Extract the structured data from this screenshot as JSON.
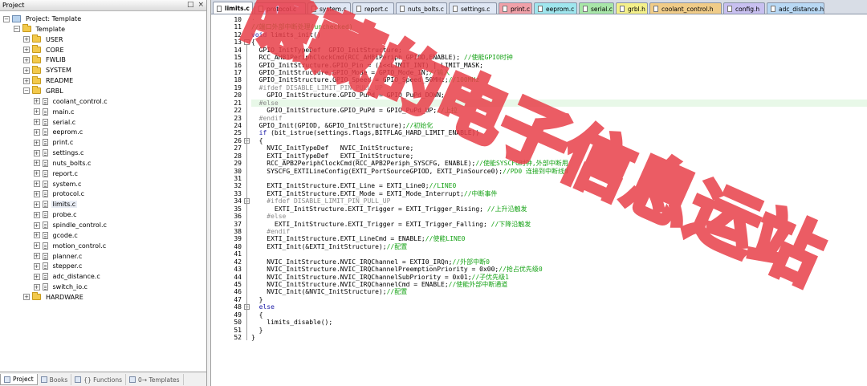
{
  "project_panel": {
    "title": "Project",
    "header_buttons": [
      "□",
      "×"
    ],
    "tree": [
      {
        "depth": 0,
        "expander": "−",
        "icon": "target",
        "label": "Project: Template"
      },
      {
        "depth": 1,
        "expander": "−",
        "icon": "folder",
        "label": "Template"
      },
      {
        "depth": 2,
        "expander": "+",
        "icon": "folder",
        "label": "USER"
      },
      {
        "depth": 2,
        "expander": "+",
        "icon": "folder",
        "label": "CORE"
      },
      {
        "depth": 2,
        "expander": "+",
        "icon": "folder",
        "label": "FWLIB"
      },
      {
        "depth": 2,
        "expander": "+",
        "icon": "folder",
        "label": "SYSTEM"
      },
      {
        "depth": 2,
        "expander": "+",
        "icon": "folder",
        "label": "README"
      },
      {
        "depth": 2,
        "expander": "−",
        "icon": "folder",
        "label": "GRBL"
      },
      {
        "depth": 3,
        "expander": "+",
        "icon": "file",
        "label": "coolant_control.c"
      },
      {
        "depth": 3,
        "expander": "+",
        "icon": "file",
        "label": "main.c"
      },
      {
        "depth": 3,
        "expander": "+",
        "icon": "file",
        "label": "serial.c"
      },
      {
        "depth": 3,
        "expander": "+",
        "icon": "file",
        "label": "eeprom.c"
      },
      {
        "depth": 3,
        "expander": "+",
        "icon": "file",
        "label": "print.c"
      },
      {
        "depth": 3,
        "expander": "+",
        "icon": "file",
        "label": "settings.c"
      },
      {
        "depth": 3,
        "expander": "+",
        "icon": "file",
        "label": "nuts_bolts.c"
      },
      {
        "depth": 3,
        "expander": "+",
        "icon": "file",
        "label": "report.c"
      },
      {
        "depth": 3,
        "expander": "+",
        "icon": "file",
        "label": "system.c"
      },
      {
        "depth": 3,
        "expander": "+",
        "icon": "file",
        "label": "protocol.c"
      },
      {
        "depth": 3,
        "expander": "+",
        "icon": "file",
        "label": "limits.c",
        "selected": true
      },
      {
        "depth": 3,
        "expander": "+",
        "icon": "file",
        "label": "probe.c"
      },
      {
        "depth": 3,
        "expander": "+",
        "icon": "file",
        "label": "spindle_control.c"
      },
      {
        "depth": 3,
        "expander": "+",
        "icon": "file",
        "label": "gcode.c"
      },
      {
        "depth": 3,
        "expander": "+",
        "icon": "file",
        "label": "motion_control.c"
      },
      {
        "depth": 3,
        "expander": "+",
        "icon": "file",
        "label": "planner.c"
      },
      {
        "depth": 3,
        "expander": "+",
        "icon": "file",
        "label": "stepper.c"
      },
      {
        "depth": 3,
        "expander": "+",
        "icon": "file",
        "label": "adc_distance.c"
      },
      {
        "depth": 3,
        "expander": "+",
        "icon": "file",
        "label": "switch_io.c"
      },
      {
        "depth": 2,
        "expander": "+",
        "icon": "folder",
        "label": "HARDWARE"
      }
    ],
    "bottom_tabs": [
      {
        "label": "Project",
        "active": true
      },
      {
        "label": "Books",
        "active": false
      },
      {
        "label": "{} Functions",
        "active": false
      },
      {
        "label": "0→ Templates",
        "active": false
      }
    ]
  },
  "editor": {
    "tabs": [
      {
        "label": "limits.c",
        "color": "#ffffff",
        "active": true
      },
      {
        "label": "protocol.c",
        "color": "#e8c8f0",
        "active": false
      },
      {
        "label": "system.c",
        "color": "#dfe7f4",
        "active": false
      },
      {
        "label": "report.c",
        "color": "#dfe7f4",
        "active": false
      },
      {
        "label": "nuts_bolts.c",
        "color": "#dfe7f4",
        "active": false
      },
      {
        "label": "settings.c",
        "color": "#dfe7f4",
        "active": false
      },
      {
        "label": "print.c",
        "color": "#f0a0a8",
        "active": false
      },
      {
        "label": "eeprom.c",
        "color": "#9fe6ee",
        "active": false
      },
      {
        "label": "serial.c",
        "color": "#a8e6a8",
        "active": false
      },
      {
        "label": "grbl.h",
        "color": "#f4f08a",
        "active": false
      },
      {
        "label": "coolant_control.h",
        "color": "#f0cc88",
        "active": false
      },
      {
        "label": "config.h",
        "color": "#c8c0f0",
        "active": false
      },
      {
        "label": "adc_distance.h",
        "color": "#b8d8f4",
        "active": false
      }
    ],
    "first_line_number": 10,
    "highlighted_line": 21,
    "code_lines": [
      [
        [
          "grey",
          "·"
        ]
      ],
      [
        [
          "cm",
          "//端口外部中断处理(unchecked)"
        ]
      ],
      [
        [
          "kw",
          "void"
        ],
        [
          "",
          " limits_init()"
        ]
      ],
      [
        [
          "",
          "{"
        ]
      ],
      [
        [
          "",
          "  GPIO_InitTypeDef  GPIO_InitStructure;"
        ]
      ],
      [
        [
          "",
          "  RCC_AHB1PeriphClockCmd(RCC_AHB1Periph_GPIOD,ENABLE); "
        ],
        [
          "cm",
          "//使能GPIO时钟"
        ]
      ],
      [
        [
          "",
          "  GPIO_InitStructure.GPIO_Pin = (1<<LIMIT_INT) | LIMIT_MASK;"
        ]
      ],
      [
        [
          "",
          "  GPIO_InitStructure.GPIO_Mode = GPIO_Mode_IN;"
        ],
        [
          "cm",
          "//输入"
        ]
      ],
      [
        [
          "",
          "  GPIO_InitStructure.GPIO_Speed = GPIO_Speed_50MHz;"
        ],
        [
          "cm",
          "//100MHz"
        ]
      ],
      [
        [
          "pp",
          "  #ifdef DISABLE_LIMIT_PIN_PULL_UP"
        ]
      ],
      [
        [
          "",
          "    GPIO_InitStructure.GPIO_PuPd = GPIO_PuPd_DOWN;"
        ]
      ],
      [
        [
          "pp",
          "  #else"
        ]
      ],
      [
        [
          "",
          "    GPIO_InitStructure.GPIO_PuPd = GPIO_PuPd_UP;"
        ],
        [
          "cm",
          "//上拉"
        ]
      ],
      [
        [
          "pp",
          "  #endif"
        ]
      ],
      [
        [
          "",
          "  GPIO_Init(GPIOD, &GPIO_InitStructure);"
        ],
        [
          "cm",
          "//初始化"
        ]
      ],
      [
        [
          "",
          "  "
        ],
        [
          "kw",
          "if"
        ],
        [
          "",
          " (bit_istrue(settings.flags,BITFLAG_HARD_LIMIT_ENABLE))"
        ]
      ],
      [
        [
          "",
          "  {"
        ]
      ],
      [
        [
          "",
          "    NVIC_InitTypeDef   NVIC_InitStructure;"
        ]
      ],
      [
        [
          "",
          "    EXTI_InitTypeDef   EXTI_InitStructure;"
        ]
      ],
      [
        [
          "",
          "    RCC_APB2PeriphClockCmd(RCC_APB2Periph_SYSCFG, ENABLE);"
        ],
        [
          "cm",
          "//使能SYSCFG时钟,外部中断用"
        ]
      ],
      [
        [
          "",
          "    SYSCFG_EXTILineConfig(EXTI_PortSourceGPIOD, EXTI_PinSource0);"
        ],
        [
          "cm",
          "//PD0 连接到中断线0"
        ]
      ],
      [
        [
          "",
          ""
        ]
      ],
      [
        [
          "",
          "    EXTI_InitStructure.EXTI_Line = EXTI_Line0;"
        ],
        [
          "cm",
          "//LINE0"
        ]
      ],
      [
        [
          "",
          "    EXTI_InitStructure.EXTI_Mode = EXTI_Mode_Interrupt;"
        ],
        [
          "cm",
          "//中断事件"
        ]
      ],
      [
        [
          "pp",
          "    #ifdef DISABLE_LIMIT_PIN_PULL_UP"
        ]
      ],
      [
        [
          "",
          "      EXTI_InitStructure.EXTI_Trigger = EXTI_Trigger_Rising; "
        ],
        [
          "cm",
          "//上升沿触发"
        ]
      ],
      [
        [
          "pp",
          "    #else"
        ]
      ],
      [
        [
          "",
          "      EXTI_InitStructure.EXTI_Trigger = EXTI_Trigger_Falling; "
        ],
        [
          "cm",
          "//下降沿触发"
        ]
      ],
      [
        [
          "pp",
          "    #endif"
        ]
      ],
      [
        [
          "",
          "    EXTI_InitStructure.EXTI_LineCmd = ENABLE;"
        ],
        [
          "cm",
          "//使能LINE0"
        ]
      ],
      [
        [
          "",
          "    EXTI_Init(&EXTI_InitStructure);"
        ],
        [
          "cm",
          "//配置"
        ]
      ],
      [
        [
          "",
          ""
        ]
      ],
      [
        [
          "",
          "    NVIC_InitStructure.NVIC_IRQChannel = EXTI0_IRQn;"
        ],
        [
          "cm",
          "//外部中断0"
        ]
      ],
      [
        [
          "",
          "    NVIC_InitStructure.NVIC_IRQChannelPreemptionPriority = 0x00;"
        ],
        [
          "cm",
          "//抢占优先级0"
        ]
      ],
      [
        [
          "",
          "    NVIC_InitStructure.NVIC_IRQChannelSubPriority = 0x01;"
        ],
        [
          "cm",
          "//子优先级1"
        ]
      ],
      [
        [
          "",
          "    NVIC_InitStructure.NVIC_IRQChannelCmd = ENABLE;"
        ],
        [
          "cm",
          "//使能外部中断通道"
        ]
      ],
      [
        [
          "",
          "    NVIC_Init(&NVIC_InitStructure);"
        ],
        [
          "cm",
          "//配置"
        ]
      ],
      [
        [
          "",
          "  }"
        ]
      ],
      [
        [
          "",
          "  "
        ],
        [
          "kw",
          "else"
        ]
      ],
      [
        [
          "",
          "  {"
        ]
      ],
      [
        [
          "",
          "    limits_disable();"
        ]
      ],
      [
        [
          "",
          "  }"
        ]
      ],
      [
        [
          "",
          "}"
        ]
      ]
    ],
    "fold_marks": [
      {
        "line": 13,
        "sign": "−"
      },
      {
        "line": 26,
        "sign": "−"
      },
      {
        "line": 34,
        "sign": "−"
      },
      {
        "line": 48,
        "sign": "−"
      }
    ]
  },
  "watermark": {
    "text": "隐藏的电子信息运站",
    "color": "#e8404a"
  }
}
